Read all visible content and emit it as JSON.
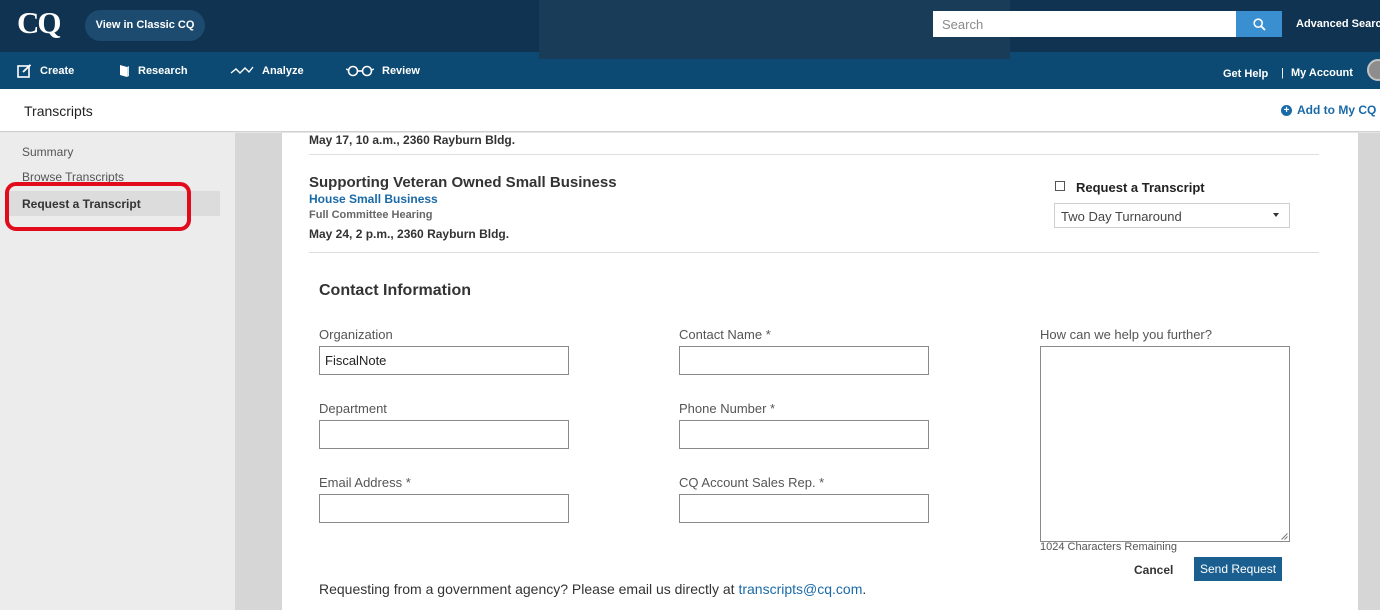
{
  "topbar": {
    "logo": "CQ",
    "classic_button": "View in Classic CQ",
    "search_placeholder": "Search",
    "advanced_search": "Advanced Search"
  },
  "nav": {
    "create": "Create",
    "research": "Research",
    "analyze": "Analyze",
    "review": "Review",
    "get_help": "Get Help",
    "separator": "|",
    "my_account": "My Account"
  },
  "subheader": {
    "title": "Transcripts",
    "add_to_mycq": "Add to My CQ"
  },
  "sidebar": {
    "items": [
      "Summary",
      "Browse Transcripts",
      "Request a Transcript"
    ],
    "active_index": 2
  },
  "hearings": {
    "previous_date": "May 17, 10 a.m., 2360 Rayburn Bldg.",
    "current": {
      "title": "Supporting Veteran Owned Small Business",
      "committee": "House Small Business",
      "type": "Full Committee Hearing",
      "date": "May 24, 2 p.m., 2360 Rayburn Bldg.",
      "request_label": "Request a Transcript",
      "request_checked": false,
      "turnaround_selected": "Two Day Turnaround"
    }
  },
  "contact": {
    "heading": "Contact Information",
    "organization_label": "Organization",
    "organization_value": "FiscalNote",
    "department_label": "Department",
    "department_value": "",
    "email_label": "Email Address *",
    "email_value": "",
    "contact_name_label": "Contact Name *",
    "contact_name_value": "",
    "phone_label": "Phone Number *",
    "phone_value": "",
    "sales_rep_label": "CQ Account Sales Rep. *",
    "sales_rep_value": "",
    "help_label": "How can we help you further?",
    "chars_remaining": "1024  Characters Remaining",
    "cancel": "Cancel",
    "send": "Send Request"
  },
  "footer": {
    "note": "Requesting from a government agency? Please email us directly at ",
    "email": "transcripts@cq.com",
    "period": "."
  },
  "colors": {
    "topbar": "#0f3350",
    "navbar": "#0d4a73",
    "accent_link": "#1a6aa8",
    "search_button": "#3a8fd1",
    "send_button": "#1a5f8f",
    "highlight_ring": "#e10b1b"
  },
  "icons": [
    "search-icon",
    "create-icon",
    "research-icon",
    "analyze-icon",
    "review-icon",
    "plus-circle-icon",
    "avatar",
    "chevron-down-icon"
  ]
}
